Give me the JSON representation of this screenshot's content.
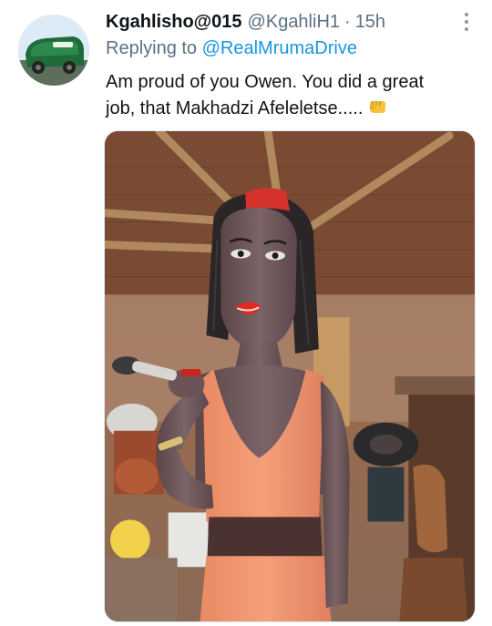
{
  "tweet": {
    "author": {
      "display_name": "Kgahlisho@015",
      "handle": "@KgahliH1",
      "avatar_icon": "avatar-icon"
    },
    "separator": "·",
    "time": "15h",
    "more_icon": "more-vertical-icon",
    "reply": {
      "prefix": "Replying to",
      "mention": "@RealMrumaDrive"
    },
    "text_line1": "Am proud of you Owen. You did a great",
    "text_line2": "job, that Makhadzi Afeleletse.....",
    "emoji_icon": "oncoming-fist-icon",
    "media": {
      "kind": "photo",
      "subject_icon": "carved-statue-photo"
    }
  },
  "colors": {
    "text_primary": "#0f1419",
    "text_secondary": "#5b7083",
    "link": "#1b95e0"
  }
}
